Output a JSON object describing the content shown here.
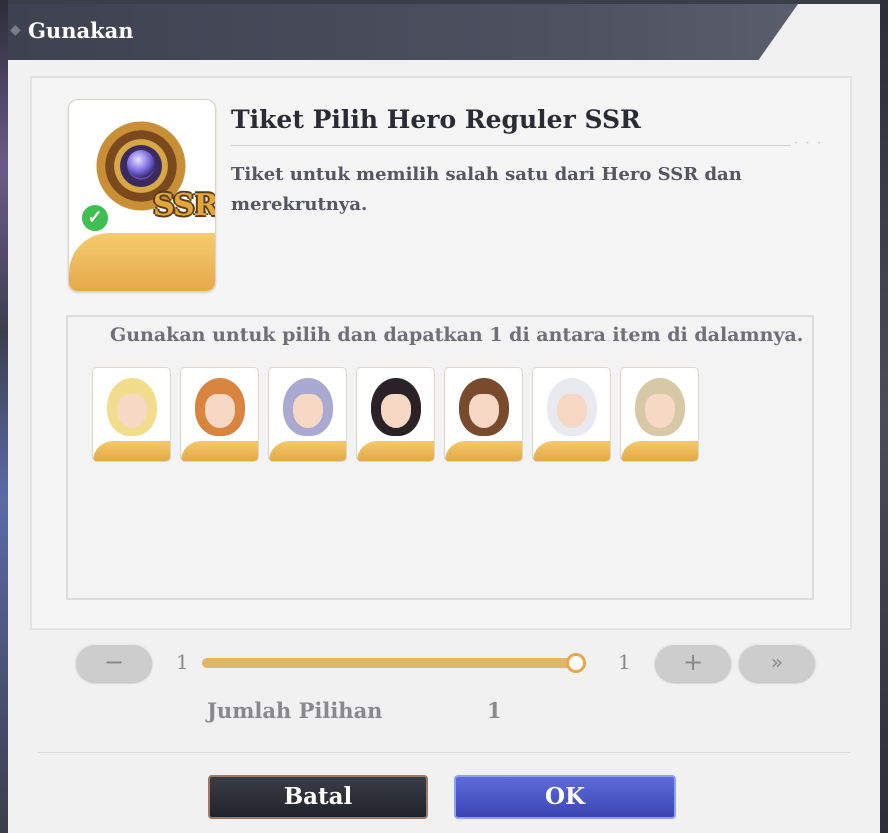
{
  "dialog": {
    "title": "Gunakan",
    "item": {
      "name": "Tiket Pilih Hero Reguler SSR",
      "description": "Tiket untuk memilih salah satu dari Hero SSR dan merekrutnya.",
      "badge": "SSR",
      "check": "✓"
    },
    "choose_text": "Gunakan untuk pilih dan dapatkan 1 di antara item di dalamnya.",
    "heroes": [
      {
        "name": "hero-1",
        "hair": "#f2dd8c"
      },
      {
        "name": "hero-2",
        "hair": "#d9843f"
      },
      {
        "name": "hero-3",
        "hair": "#a9a9d2"
      },
      {
        "name": "hero-4",
        "hair": "#2a2226"
      },
      {
        "name": "hero-5",
        "hair": "#7a4a2c"
      },
      {
        "name": "hero-6",
        "hair": "#e9eaf0"
      },
      {
        "name": "hero-7",
        "hair": "#d8c9a6"
      }
    ],
    "slider": {
      "min": "1",
      "max": "1",
      "minus": "−",
      "plus": "+",
      "max_button": "»",
      "value_fraction": 1.0
    },
    "quantity": {
      "label": "Jumlah Pilihan",
      "value": "1"
    },
    "buttons": {
      "cancel": "Batal",
      "ok": "OK"
    }
  }
}
